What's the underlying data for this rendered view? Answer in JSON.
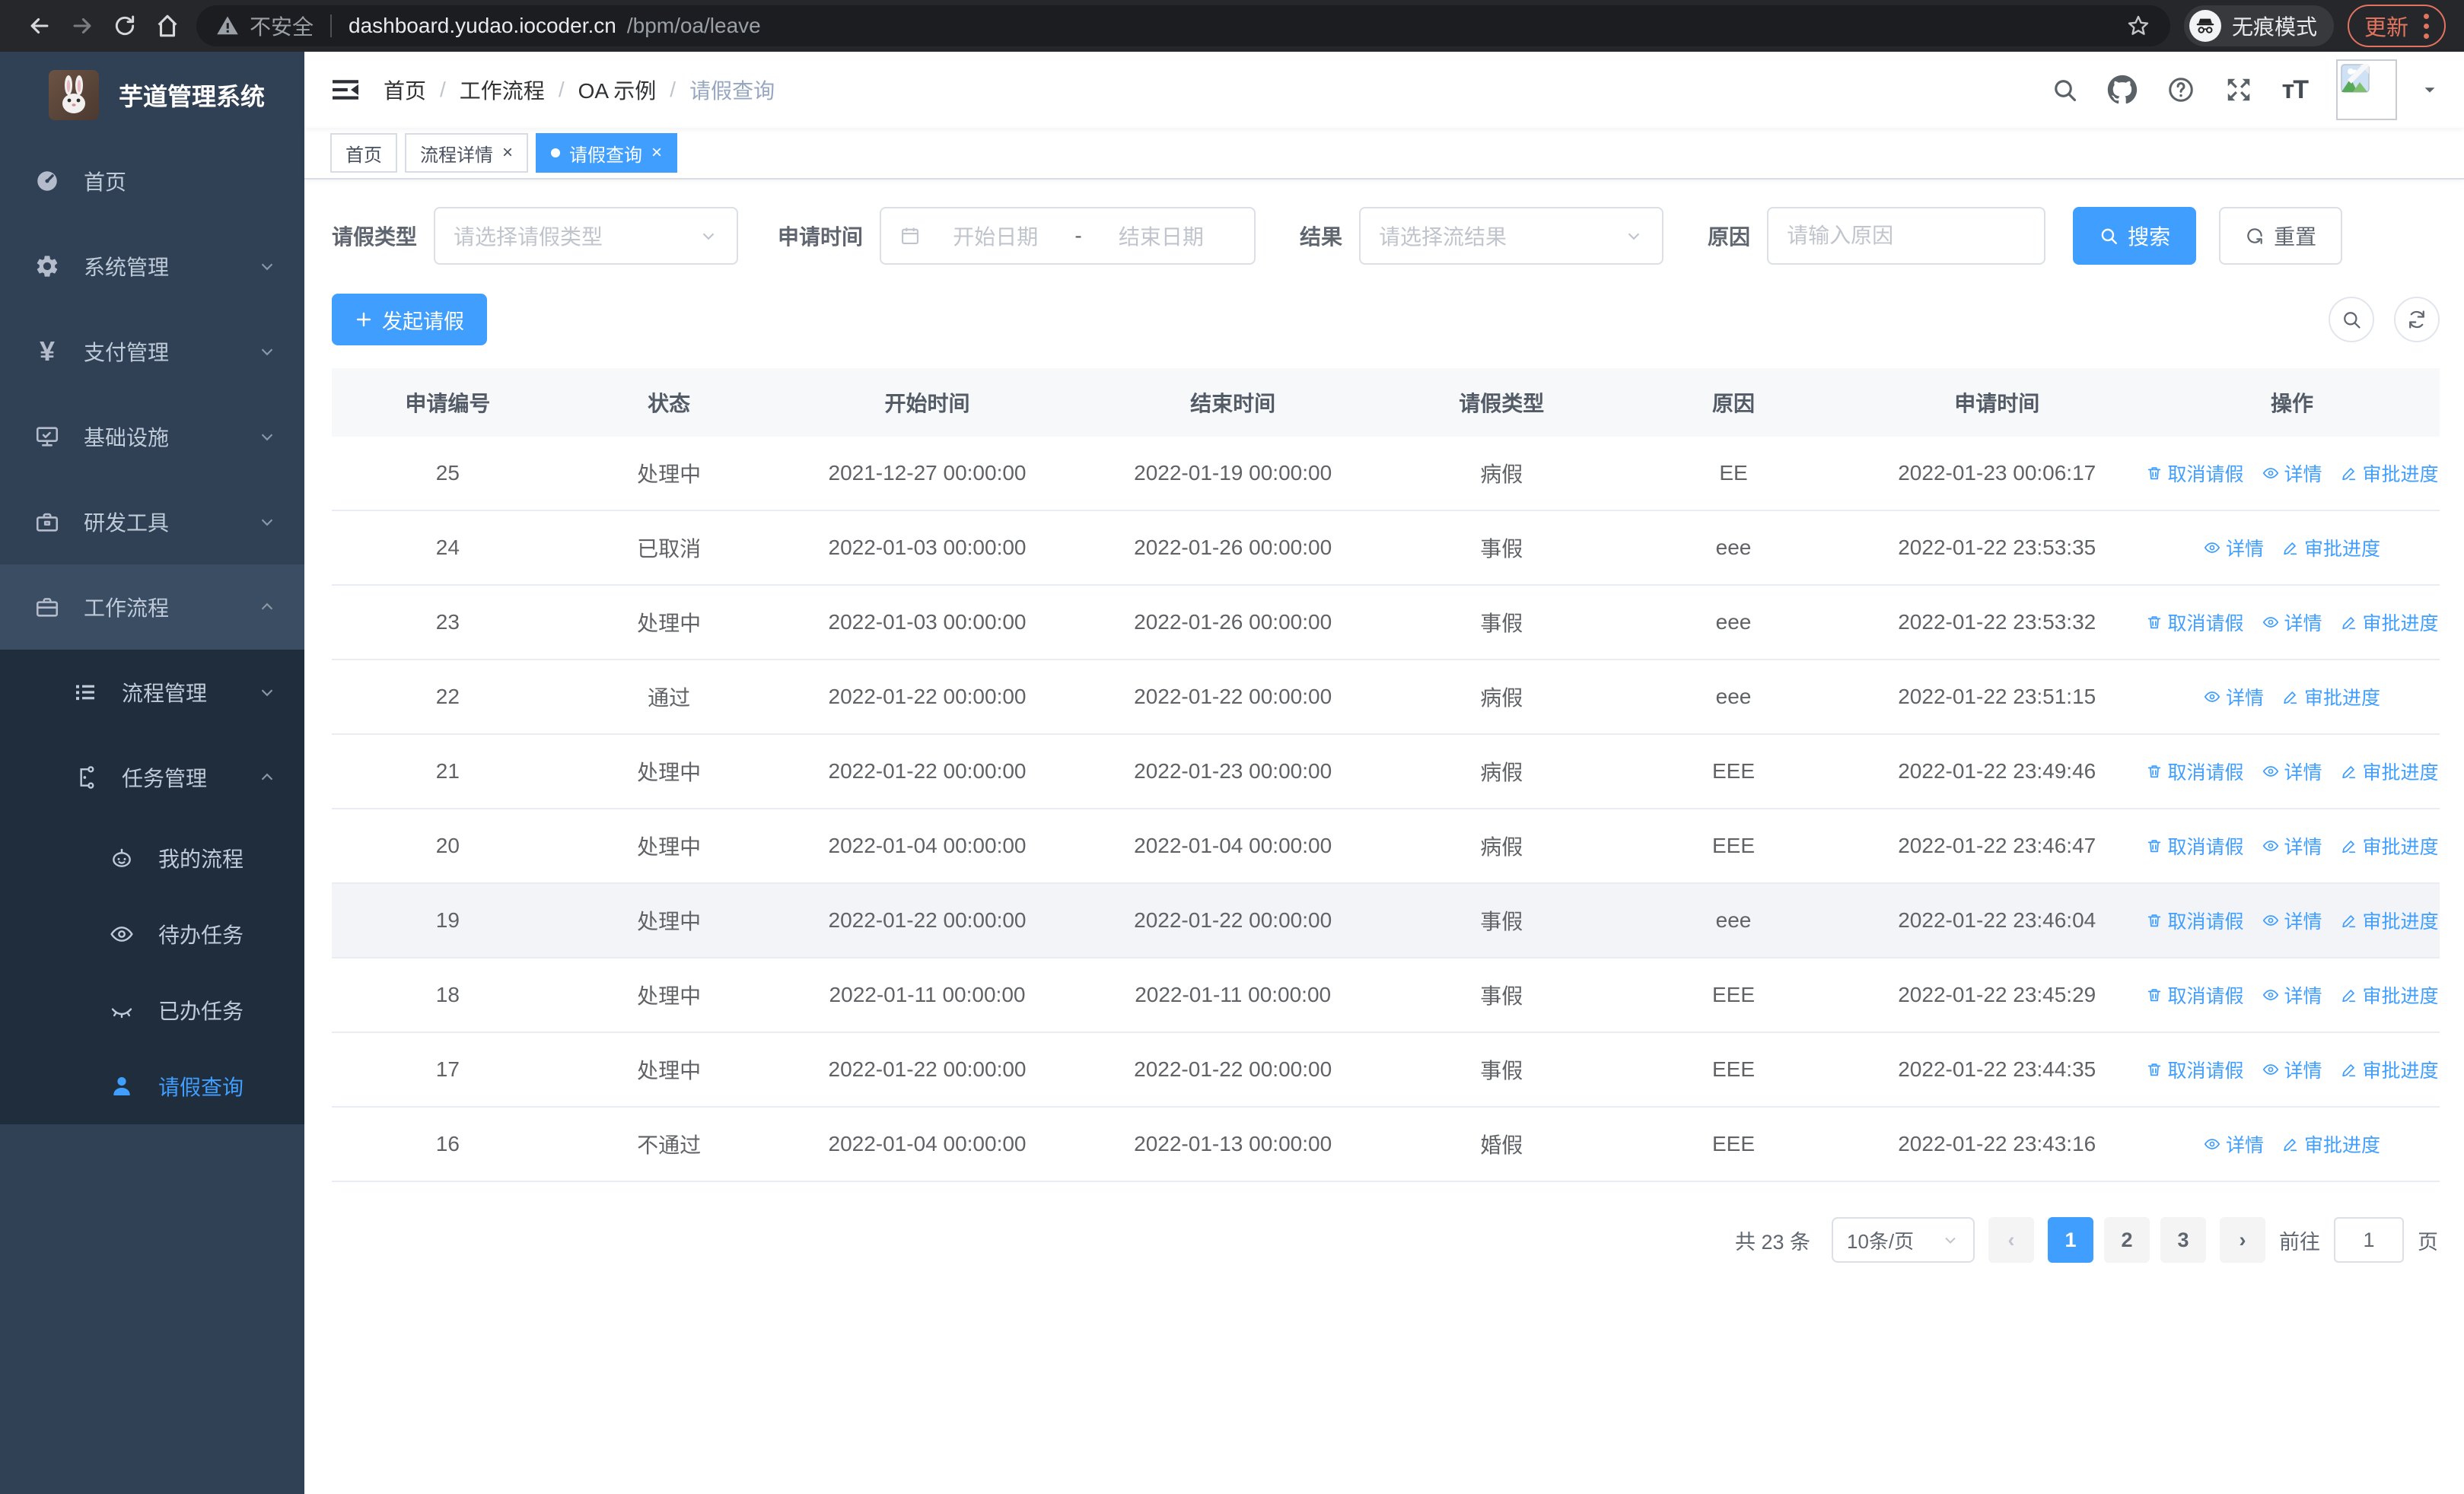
{
  "browser": {
    "security_label": "不安全",
    "url_host": "dashboard.yudao.iocoder.cn",
    "url_path": "/bpm/oa/leave",
    "incognito_label": "无痕模式",
    "update_label": "更新"
  },
  "sidebar": {
    "title": "芋道管理系统",
    "menu": [
      {
        "label": "首页",
        "icon": "dashboard-icon"
      },
      {
        "label": "系统管理",
        "icon": "gear-icon"
      },
      {
        "label": "支付管理",
        "icon": "yen-icon"
      },
      {
        "label": "基础设施",
        "icon": "monitor-icon"
      },
      {
        "label": "研发工具",
        "icon": "toolbox-icon"
      },
      {
        "label": "工作流程",
        "icon": "briefcase-icon"
      }
    ],
    "sub1": "流程管理",
    "sub2": "任务管理",
    "sub2_children": [
      "我的流程",
      "待办任务",
      "已办任务",
      "请假查询"
    ]
  },
  "header": {
    "breadcrumb": [
      "首页",
      "工作流程",
      "OA 示例",
      "请假查询"
    ]
  },
  "tabs": [
    {
      "label": "首页"
    },
    {
      "label": "流程详情"
    },
    {
      "label": "请假查询"
    }
  ],
  "filters": {
    "leave_type_label": "请假类型",
    "leave_type_placeholder": "请选择请假类型",
    "apply_time_label": "申请时间",
    "date_start_placeholder": "开始日期",
    "date_separator": "-",
    "date_end_placeholder": "结束日期",
    "result_label": "结果",
    "result_placeholder": "请选择流结果",
    "reason_label": "原因",
    "reason_placeholder": "请输入原因",
    "search_label": "搜索",
    "reset_label": "重置"
  },
  "toolbar": {
    "create_label": "发起请假"
  },
  "table": {
    "columns": [
      "申请编号",
      "状态",
      "开始时间",
      "结束时间",
      "请假类型",
      "原因",
      "申请时间",
      "操作"
    ],
    "action_labels": {
      "cancel": "取消请假",
      "detail": "详情",
      "progress": "审批进度"
    },
    "rows": [
      {
        "id": "25",
        "status": "处理中",
        "start": "2021-12-27 00:00:00",
        "end": "2022-01-19 00:00:00",
        "type": "病假",
        "reason": "EE",
        "apply": "2022-01-23 00:06:17",
        "actions": [
          "cancel",
          "detail",
          "progress"
        ],
        "highlight": false
      },
      {
        "id": "24",
        "status": "已取消",
        "start": "2022-01-03 00:00:00",
        "end": "2022-01-26 00:00:00",
        "type": "事假",
        "reason": "eee",
        "apply": "2022-01-22 23:53:35",
        "actions": [
          "detail",
          "progress"
        ],
        "highlight": false
      },
      {
        "id": "23",
        "status": "处理中",
        "start": "2022-01-03 00:00:00",
        "end": "2022-01-26 00:00:00",
        "type": "事假",
        "reason": "eee",
        "apply": "2022-01-22 23:53:32",
        "actions": [
          "cancel",
          "detail",
          "progress"
        ],
        "highlight": false
      },
      {
        "id": "22",
        "status": "通过",
        "start": "2022-01-22 00:00:00",
        "end": "2022-01-22 00:00:00",
        "type": "病假",
        "reason": "eee",
        "apply": "2022-01-22 23:51:15",
        "actions": [
          "detail",
          "progress"
        ],
        "highlight": false
      },
      {
        "id": "21",
        "status": "处理中",
        "start": "2022-01-22 00:00:00",
        "end": "2022-01-23 00:00:00",
        "type": "病假",
        "reason": "EEE",
        "apply": "2022-01-22 23:49:46",
        "actions": [
          "cancel",
          "detail",
          "progress"
        ],
        "highlight": false
      },
      {
        "id": "20",
        "status": "处理中",
        "start": "2022-01-04 00:00:00",
        "end": "2022-01-04 00:00:00",
        "type": "病假",
        "reason": "EEE",
        "apply": "2022-01-22 23:46:47",
        "actions": [
          "cancel",
          "detail",
          "progress"
        ],
        "highlight": false
      },
      {
        "id": "19",
        "status": "处理中",
        "start": "2022-01-22 00:00:00",
        "end": "2022-01-22 00:00:00",
        "type": "事假",
        "reason": "eee",
        "apply": "2022-01-22 23:46:04",
        "actions": [
          "cancel",
          "detail",
          "progress"
        ],
        "highlight": true
      },
      {
        "id": "18",
        "status": "处理中",
        "start": "2022-01-11 00:00:00",
        "end": "2022-01-11 00:00:00",
        "type": "事假",
        "reason": "EEE",
        "apply": "2022-01-22 23:45:29",
        "actions": [
          "cancel",
          "detail",
          "progress"
        ],
        "highlight": false
      },
      {
        "id": "17",
        "status": "处理中",
        "start": "2022-01-22 00:00:00",
        "end": "2022-01-22 00:00:00",
        "type": "事假",
        "reason": "EEE",
        "apply": "2022-01-22 23:44:35",
        "actions": [
          "cancel",
          "detail",
          "progress"
        ],
        "highlight": false
      },
      {
        "id": "16",
        "status": "不通过",
        "start": "2022-01-04 00:00:00",
        "end": "2022-01-13 00:00:00",
        "type": "婚假",
        "reason": "EEE",
        "apply": "2022-01-22 23:43:16",
        "actions": [
          "detail",
          "progress"
        ],
        "highlight": false
      }
    ]
  },
  "pagination": {
    "total_label": "共 23 条",
    "page_size_label": "10条/页",
    "pages": [
      "1",
      "2",
      "3"
    ],
    "active_page": "1",
    "goto_label": "前往",
    "goto_value": "1",
    "page_unit_label": "页"
  },
  "colors": {
    "primary": "#409eff",
    "sidebar_bg": "#304156",
    "submenu_bg": "#1f2d3d",
    "update_accent": "#e2735f"
  }
}
